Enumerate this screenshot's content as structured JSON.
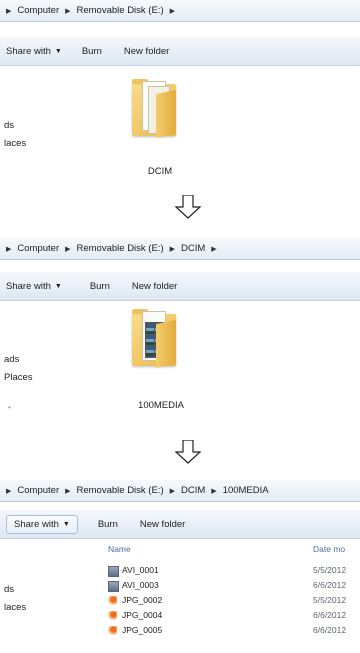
{
  "panels": [
    {
      "breadcrumb": [
        "Computer",
        "Removable Disk (E:)"
      ],
      "toolbar": {
        "share_with": "Share with",
        "burn": "Burn",
        "new_folder": "New folder"
      },
      "nav": [
        "ds",
        "laces"
      ],
      "folder_label": "DCIM"
    },
    {
      "breadcrumb": [
        "Computer",
        "Removable Disk (E:)",
        "DCIM"
      ],
      "toolbar": {
        "share_with": "Share with",
        "burn": "Burn",
        "new_folder": "New folder"
      },
      "nav": [
        "ads",
        "Places"
      ],
      "folder_label": "100MEDIA"
    },
    {
      "breadcrumb": [
        "Computer",
        "Removable Disk (E:)",
        "DCIM",
        "100MEDIA"
      ],
      "toolbar": {
        "share_with": "Share with",
        "burn": "Burn",
        "new_folder": "New folder"
      },
      "nav": [
        "ds",
        "laces"
      ],
      "columns": {
        "name": "Name",
        "date": "Date mo"
      },
      "files": [
        {
          "name": "AVI_0001",
          "date": "5/5/2012",
          "icon": "video-file-icon"
        },
        {
          "name": "AVI_0003",
          "date": "6/6/2012",
          "icon": "video-file-icon"
        },
        {
          "name": "JPG_0002",
          "date": "5/5/2012",
          "icon": "jpeg-file-icon"
        },
        {
          "name": "JPG_0004",
          "date": "6/6/2012",
          "icon": "jpeg-file-icon"
        },
        {
          "name": "JPG_0005",
          "date": "6/6/2012",
          "icon": "jpeg-file-icon"
        }
      ]
    }
  ],
  "colors": {
    "address_bar_border": "#b9c9da",
    "toolbar_gradient_top": "#f4f8fc",
    "toolbar_gradient_bottom": "#dde7f2",
    "column_header_text": "#4d6f99"
  }
}
